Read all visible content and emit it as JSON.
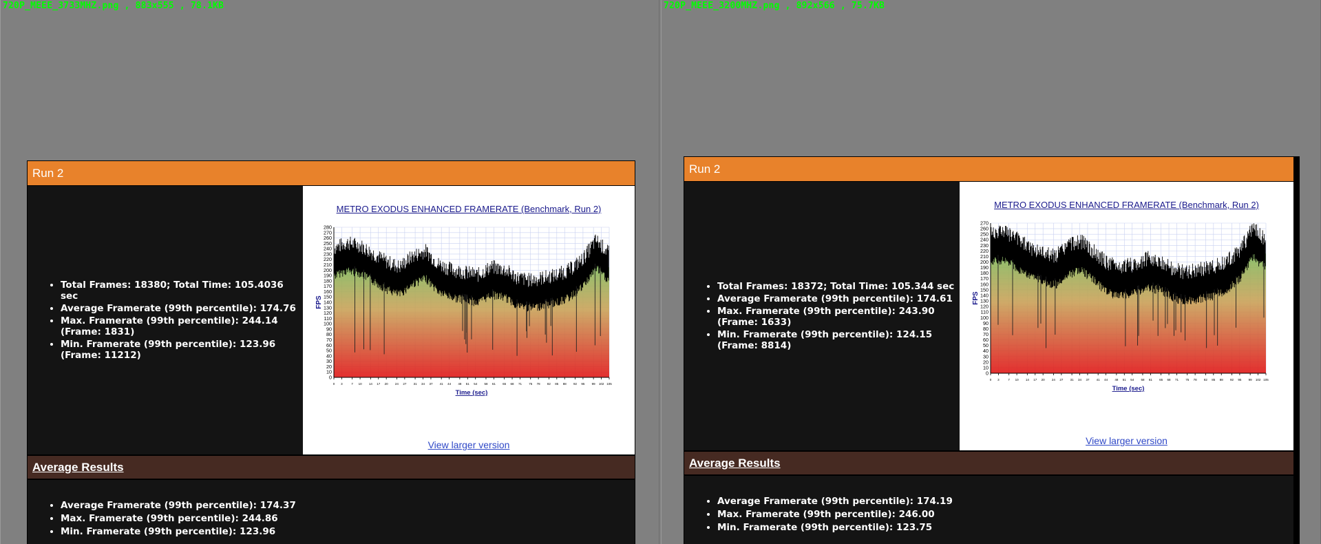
{
  "panes": [
    {
      "file_label": "720P_MEEE_3733MHZ.png , 883x555 , 78.1KB",
      "run_title": "Run 2",
      "stats": [
        "Total Frames: 18380; Total Time: 105.4036 sec",
        "Average Framerate (99th percentile): 174.76",
        "Max. Framerate (99th percentile): 244.14 (Frame: 1831)",
        "Min. Framerate (99th percentile): 123.96 (Frame: 11212)"
      ],
      "chart_title": "METRO EXODUS ENHANCED FRAMERATE (Benchmark, Run 2)",
      "view_larger": "View larger version",
      "avg_title": "Average Results",
      "avg_stats": [
        "Average Framerate (99th percentile): 174.37",
        "Max. Framerate (99th percentile): 244.86",
        "Min. Framerate (99th percentile): 123.96"
      ]
    },
    {
      "file_label": "720P_MEEE_3200MHZ.png , 892x566 , 75.7KB",
      "run_title": "Run 2",
      "stats": [
        "Total Frames: 18372; Total Time: 105.344 sec",
        "Average Framerate (99th percentile): 174.61",
        "Max. Framerate (99th percentile): 243.90 (Frame: 1633)",
        "Min. Framerate (99th percentile): 124.15 (Frame: 8814)"
      ],
      "chart_title": "METRO EXODUS ENHANCED FRAMERATE (Benchmark, Run 2)",
      "view_larger": "View larger version",
      "avg_title": "Average Results",
      "avg_stats": [
        "Average Framerate (99th percentile): 174.19",
        "Max. Framerate (99th percentile): 246.00",
        "Min. Framerate (99th percentile): 123.75"
      ]
    }
  ],
  "chart_data": [
    {
      "type": "line",
      "title": "METRO EXODUS ENHANCED FRAMERATE (Benchmark, Run 2)",
      "xlabel": "Time (sec)",
      "ylabel": "FPS",
      "ylim": [
        0,
        280
      ],
      "xlim": [
        0,
        105
      ],
      "yticks": [
        0,
        10,
        20,
        30,
        40,
        50,
        60,
        70,
        80,
        90,
        100,
        110,
        120,
        130,
        140,
        150,
        160,
        170,
        180,
        190,
        200,
        210,
        220,
        230,
        240,
        250,
        260,
        270,
        280
      ],
      "xticks": [
        0,
        3,
        7,
        10,
        14,
        17,
        20,
        24,
        27,
        31,
        34,
        37,
        41,
        44,
        48,
        51,
        54,
        58,
        61,
        65,
        68,
        71,
        75,
        78,
        82,
        85,
        88,
        92,
        95,
        99,
        102,
        105
      ],
      "grid": true,
      "series": [
        {
          "x": [
            0,
            5,
            10,
            15,
            20,
            25,
            30,
            35,
            40,
            45,
            50,
            55,
            60,
            65,
            70,
            75,
            80,
            85,
            90,
            95,
            100,
            105
          ],
          "values": [
            215,
            225,
            220,
            205,
            190,
            180,
            200,
            210,
            185,
            175,
            170,
            165,
            180,
            175,
            160,
            155,
            160,
            165,
            175,
            195,
            230,
            205
          ]
        }
      ]
    },
    {
      "type": "line",
      "title": "METRO EXODUS ENHANCED FRAMERATE (Benchmark, Run 2)",
      "xlabel": "Time (sec)",
      "ylabel": "FPS",
      "ylim": [
        0,
        270
      ],
      "xlim": [
        0,
        105
      ],
      "yticks": [
        0,
        10,
        20,
        30,
        40,
        50,
        60,
        70,
        80,
        90,
        100,
        110,
        120,
        130,
        140,
        150,
        160,
        170,
        180,
        190,
        200,
        210,
        220,
        230,
        240,
        250,
        260,
        270
      ],
      "xticks": [
        0,
        3,
        7,
        10,
        14,
        17,
        20,
        24,
        27,
        31,
        34,
        37,
        41,
        44,
        48,
        51,
        54,
        58,
        61,
        65,
        68,
        71,
        75,
        78,
        82,
        85,
        88,
        92,
        95,
        99,
        102,
        105
      ],
      "grid": true,
      "series": [
        {
          "x": [
            0,
            5,
            10,
            15,
            20,
            25,
            30,
            35,
            40,
            45,
            50,
            55,
            60,
            65,
            70,
            75,
            80,
            85,
            90,
            95,
            100,
            105
          ],
          "values": [
            225,
            230,
            215,
            200,
            190,
            185,
            205,
            210,
            190,
            170,
            165,
            170,
            180,
            175,
            160,
            155,
            160,
            165,
            175,
            195,
            235,
            215
          ]
        }
      ]
    }
  ],
  "colors": {
    "background": "#808080",
    "header": "#e8822b",
    "avg_header": "#462a22",
    "panel": "#141414",
    "file_label": "#00ff00"
  }
}
